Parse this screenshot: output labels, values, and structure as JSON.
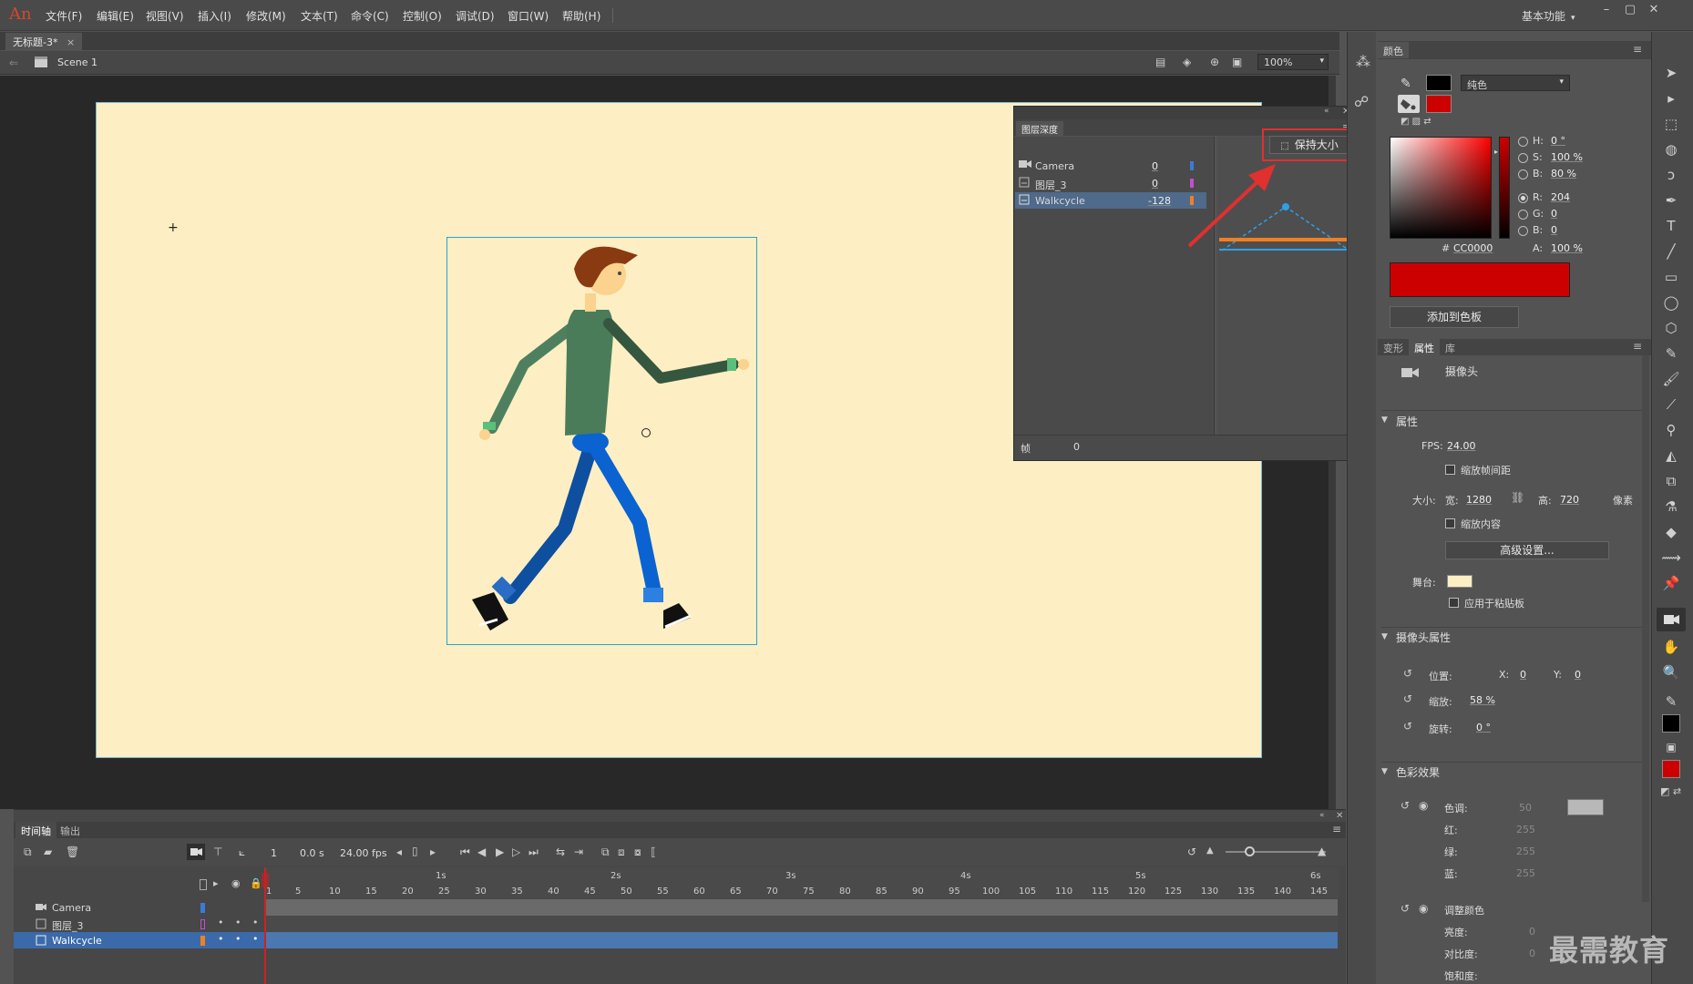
{
  "app": {
    "logo": "An"
  },
  "menu": [
    "文件(F)",
    "编辑(E)",
    "视图(V)",
    "插入(I)",
    "修改(M)",
    "文本(T)",
    "命令(C)",
    "控制(O)",
    "调试(D)",
    "窗口(W)",
    "帮助(H)"
  ],
  "workspace": "基本功能",
  "document": {
    "tab": "无标题-3*",
    "close": "×",
    "scene": "Scene 1",
    "zoom": "100%"
  },
  "depth_panel": {
    "title": "图层深度",
    "keep_size_button": "保持大小",
    "rows": [
      {
        "name": "Camera",
        "depth": "0",
        "color": "#3a7bd5"
      },
      {
        "name": "图层_3",
        "depth": "0",
        "color": "#c050d0"
      },
      {
        "name": "Walkcycle",
        "depth": "-128",
        "color": "#f08020"
      }
    ],
    "frame_label": "帧",
    "frame_value": "0"
  },
  "color_panel": {
    "tab": "颜色",
    "fill_type": "纯色",
    "hsb": {
      "h_label": "H:",
      "h": "0 °",
      "s_label": "S:",
      "s": "100 %",
      "b_label": "B:",
      "b": "80 %"
    },
    "rgb": {
      "r_label": "R:",
      "r": "204",
      "g_label": "G:",
      "g": "0",
      "b_label": "B:",
      "b": "0"
    },
    "hex_label": "#",
    "hex": "CC0000",
    "alpha_label": "A:",
    "alpha": "100 %",
    "swatch_color": "#cc0000",
    "add_swatch_button": "添加到色板"
  },
  "properties": {
    "tabs": [
      "变形",
      "属性",
      "库"
    ],
    "object_type": "摄像头",
    "section_props": "属性",
    "fps_label": "FPS:",
    "fps": "24.00",
    "scale_spans": "缩放帧间距",
    "size_label": "大小:",
    "width_label": "宽:",
    "width": "1280",
    "height_label": "高:",
    "height": "720",
    "unit": "像素",
    "scale_content": "缩放内容",
    "advanced_button": "高级设置...",
    "stage_label": "舞台:",
    "stage_color": "#fdefc3",
    "apply_pasteboard": "应用于粘贴板",
    "section_camera": "摄像头属性",
    "position_label": "位置:",
    "x_label": "X:",
    "x": "0",
    "y_label": "Y:",
    "y": "0",
    "zoom_label": "缩放:",
    "zoom": "58 %",
    "rotate_label": "旋转:",
    "rotate": "0 °",
    "section_color": "色彩效果",
    "tint_label": "色调:",
    "tint": "50",
    "red_label": "红:",
    "red": "255",
    "green_label": "绿:",
    "green": "255",
    "blue_label": "蓝:",
    "blue": "255",
    "adjust_label": "调整颜色",
    "brightness_label": "亮度:",
    "brightness": "0",
    "contrast_label": "对比度:",
    "contrast": "0",
    "saturation_label": "饱和度:"
  },
  "timeline": {
    "tabs": [
      "时间轴",
      "输出"
    ],
    "frame": "1",
    "time": "0.0 s",
    "fps": "24.00 fps",
    "seconds": [
      "1s",
      "2s",
      "3s",
      "4s",
      "5s",
      "6s"
    ],
    "frame_ticks": [
      "1",
      "5",
      "10",
      "15",
      "20",
      "25",
      "30",
      "35",
      "40",
      "45",
      "50",
      "55",
      "60",
      "65",
      "70",
      "75",
      "80",
      "85",
      "90",
      "95",
      "100",
      "105",
      "110",
      "115",
      "120",
      "125",
      "130",
      "135",
      "140",
      "145"
    ],
    "layers": [
      {
        "name": "Camera",
        "color": "#3a7bd5"
      },
      {
        "name": "图层_3",
        "color": "#c050d0"
      },
      {
        "name": "Walkcycle",
        "color": "#f08020"
      }
    ]
  },
  "watermark": "最需教育"
}
